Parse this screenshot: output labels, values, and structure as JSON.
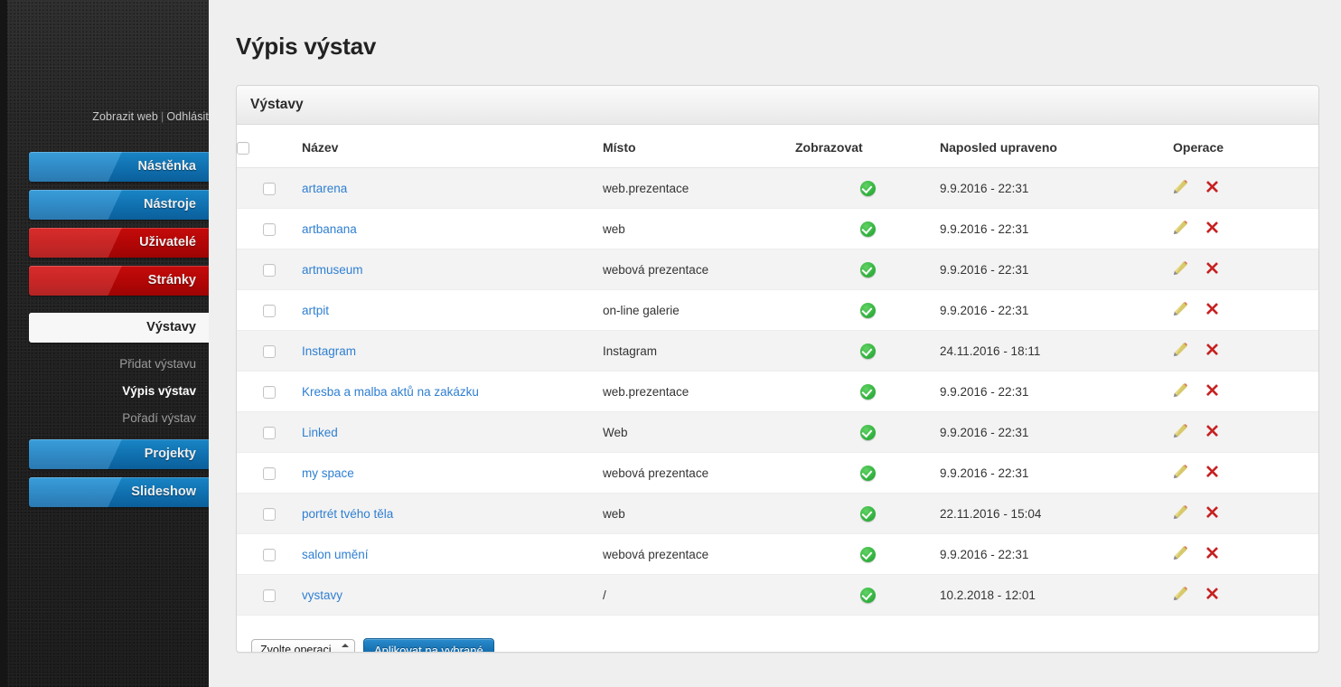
{
  "sidebar": {
    "top_links": {
      "view_site": "Zobrazit web",
      "separator": "|",
      "logout": "Odhlásit"
    },
    "buttons": [
      {
        "label": "Nástěnka",
        "color": "blue"
      },
      {
        "label": "Nástroje",
        "color": "blue"
      },
      {
        "label": "Uživatelé",
        "color": "red"
      },
      {
        "label": "Stránky",
        "color": "red"
      }
    ],
    "active_section": {
      "label": "Výstavy"
    },
    "sub_items": [
      {
        "label": "Přidat výstavu",
        "current": false
      },
      {
        "label": "Výpis výstav",
        "current": true
      },
      {
        "label": "Pořadí výstav",
        "current": false
      }
    ],
    "buttons_bottom": [
      {
        "label": "Projekty",
        "color": "blue"
      },
      {
        "label": "Slideshow",
        "color": "blue"
      }
    ]
  },
  "page": {
    "title": "Výpis výstav"
  },
  "panel": {
    "header_title": "Výstavy",
    "columns": [
      "",
      "Název",
      "Místo",
      "Zobrazovat",
      "Naposled upraveno",
      "Operace"
    ],
    "rows": [
      {
        "name": "artarena",
        "place": "web.prezentace",
        "visible": true,
        "modified": "9.9.2016 - 22:31"
      },
      {
        "name": "artbanana",
        "place": "web",
        "visible": true,
        "modified": "9.9.2016 - 22:31"
      },
      {
        "name": "artmuseum",
        "place": "webová prezentace",
        "visible": true,
        "modified": "9.9.2016 - 22:31"
      },
      {
        "name": "artpit",
        "place": "on-line galerie",
        "visible": true,
        "modified": "9.9.2016 - 22:31"
      },
      {
        "name": "Instagram",
        "place": "Instagram",
        "visible": true,
        "modified": "24.11.2016 - 18:11"
      },
      {
        "name": "Kresba a malba aktů na zakázku",
        "place": "web.prezentace",
        "visible": true,
        "modified": "9.9.2016 - 22:31"
      },
      {
        "name": "Linked",
        "place": "Web",
        "visible": true,
        "modified": "9.9.2016 - 22:31"
      },
      {
        "name": "my space",
        "place": "webová prezentace",
        "visible": true,
        "modified": "9.9.2016 - 22:31"
      },
      {
        "name": "portrét tvého těla",
        "place": "web",
        "visible": true,
        "modified": "22.11.2016 - 15:04"
      },
      {
        "name": "salon umění",
        "place": "webová prezentace",
        "visible": true,
        "modified": "9.9.2016 - 22:31"
      },
      {
        "name": "vystavy",
        "place": "/",
        "visible": true,
        "modified": "10.2.2018 - 12:01"
      }
    ],
    "bulk": {
      "select_value": "Zvolte operaci...",
      "apply_label": "Aplikovat na vybrané"
    }
  },
  "colors": {
    "accent_blue": "#1873b4",
    "accent_red": "#c00606",
    "link_blue": "#2f7fd1",
    "ok_green": "#35b441",
    "delete_red": "#c62121"
  }
}
